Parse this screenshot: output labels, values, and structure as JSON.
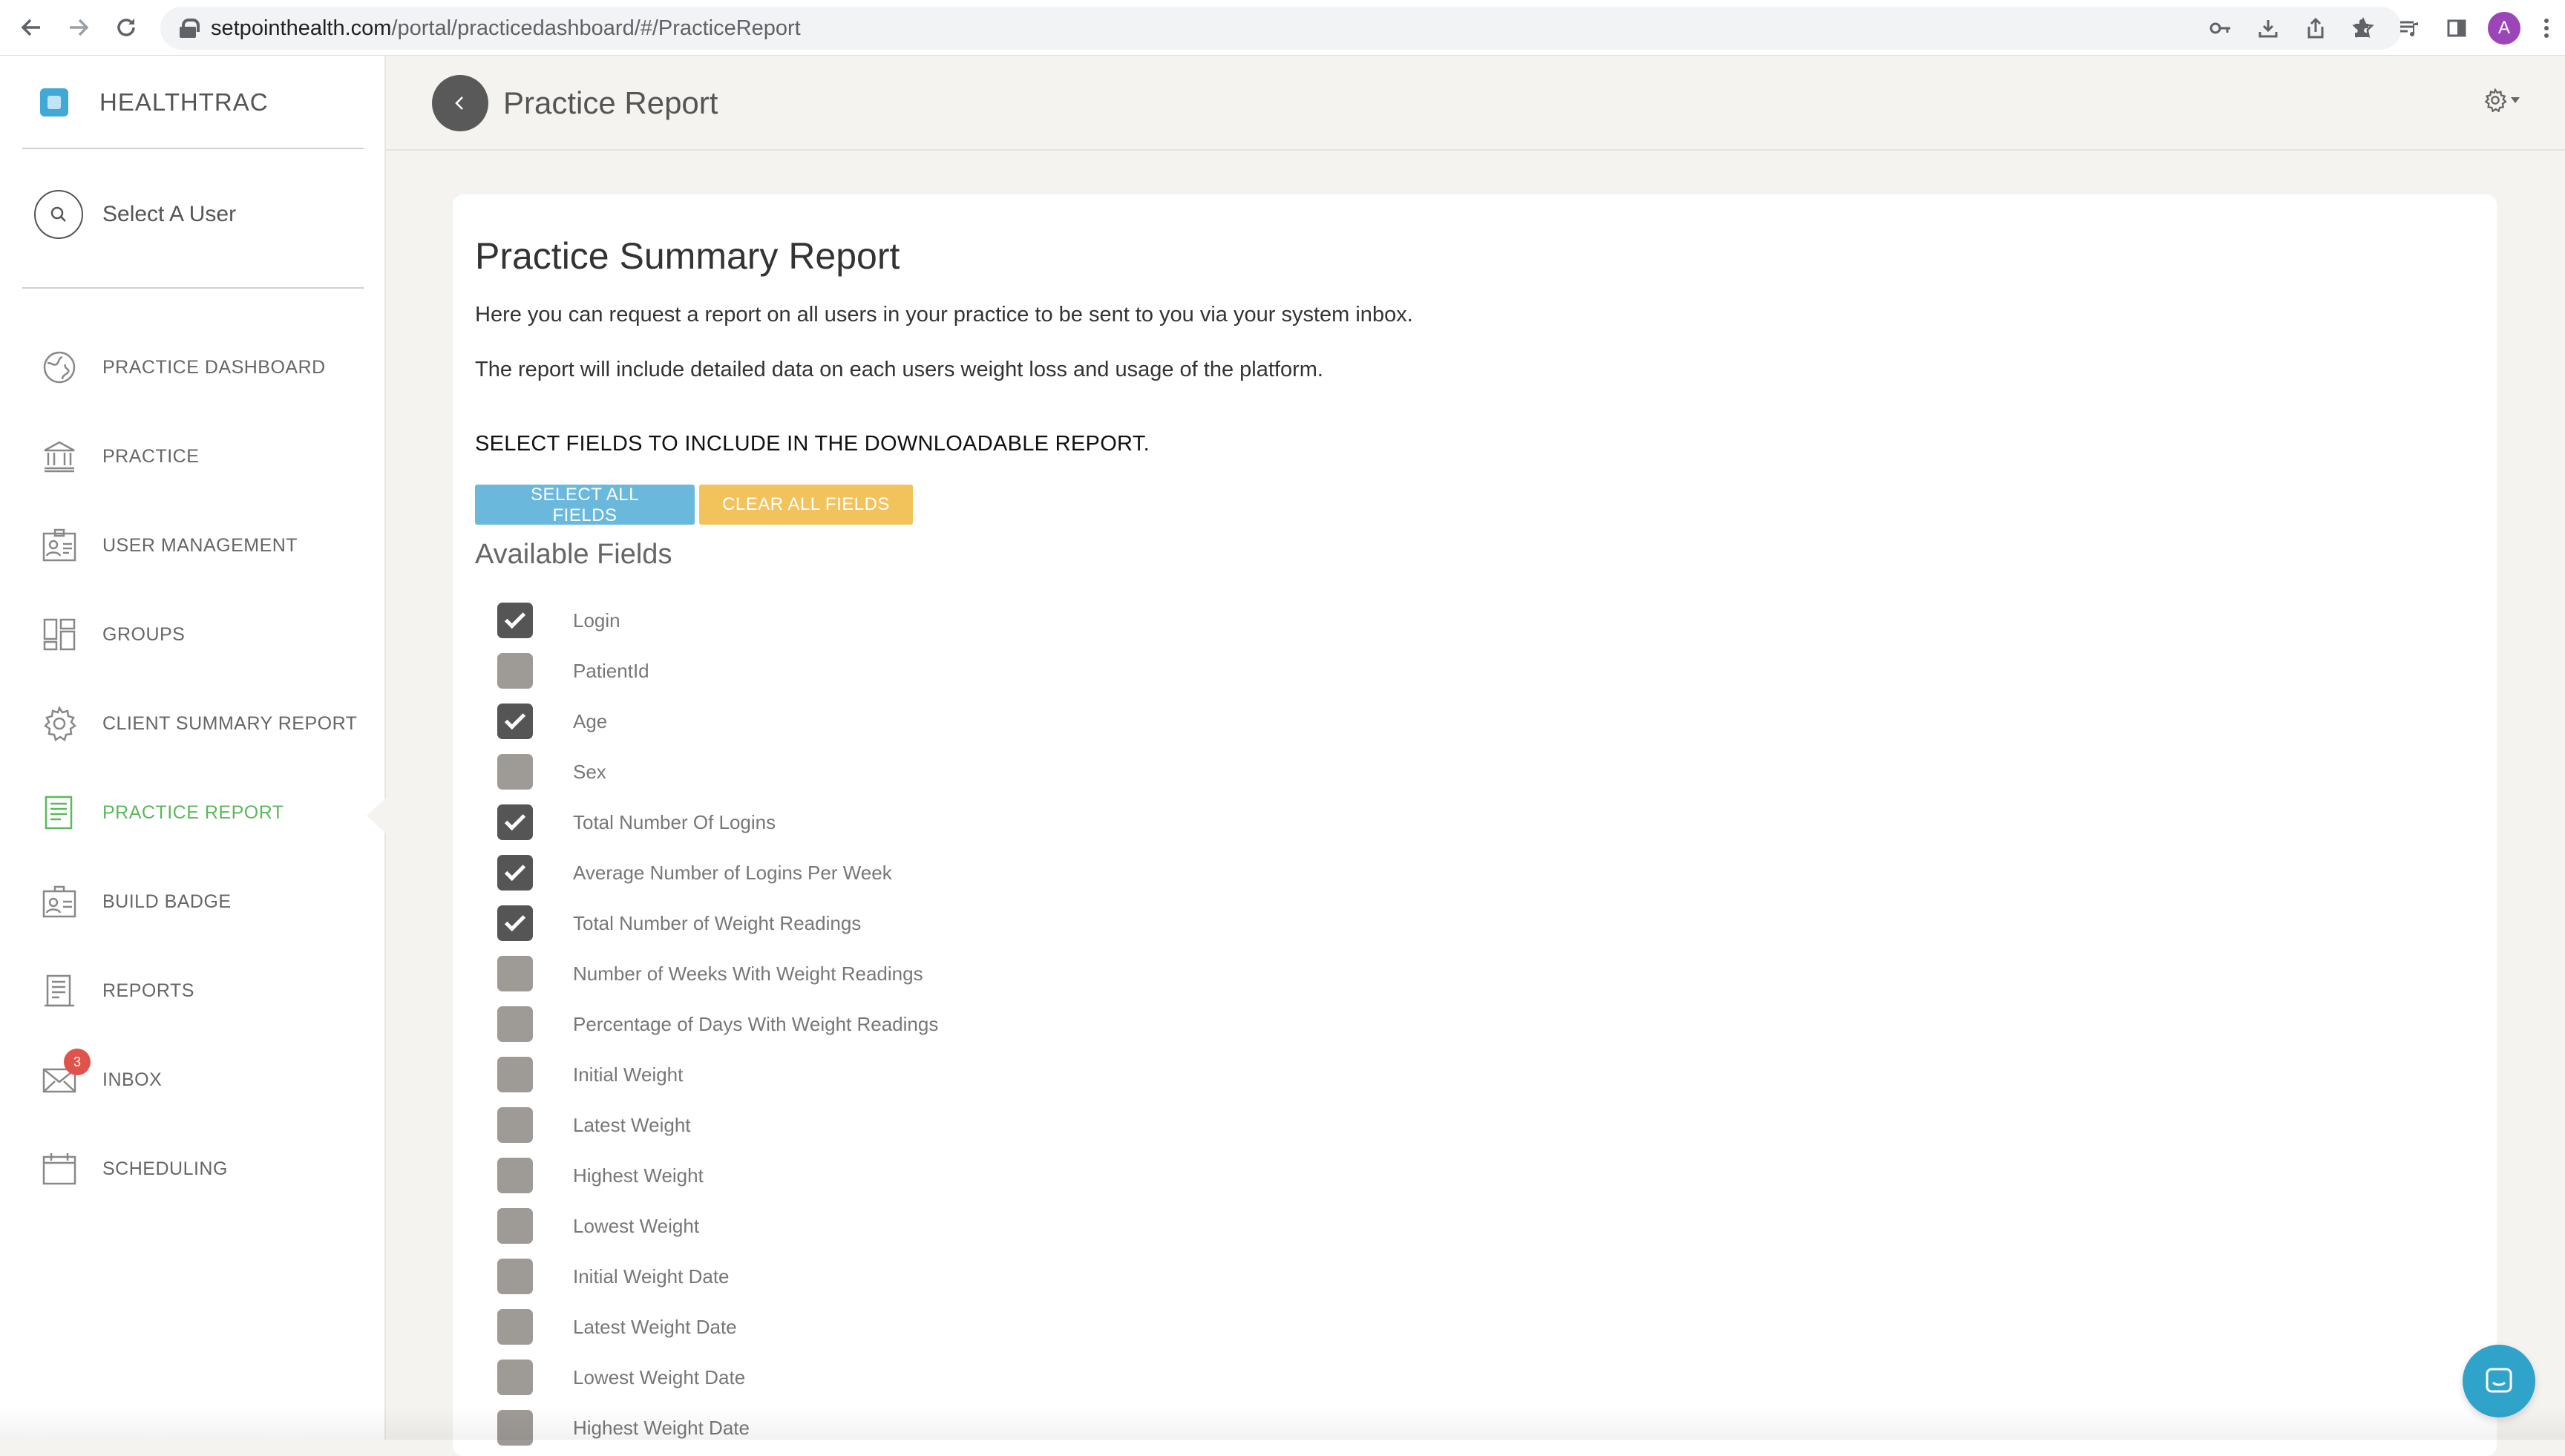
{
  "browser": {
    "url_host": "setpointhealth.com",
    "url_path": "/portal/practicedashboard/#/PracticeReport",
    "avatar_letter": "A"
  },
  "sidebar": {
    "brand": "HEALTHTRAC",
    "select_user": "Select A User",
    "items": [
      {
        "label": "PRACTICE DASHBOARD",
        "icon": "globe-icon"
      },
      {
        "label": "PRACTICE",
        "icon": "bank-icon"
      },
      {
        "label": "USER MANAGEMENT",
        "icon": "id-card-icon"
      },
      {
        "label": "GROUPS",
        "icon": "grid-icon"
      },
      {
        "label": "CLIENT SUMMARY REPORT",
        "icon": "gear-icon"
      },
      {
        "label": "PRACTICE REPORT",
        "icon": "document-icon",
        "active": true
      },
      {
        "label": "BUILD BADGE",
        "icon": "badge-icon"
      },
      {
        "label": "REPORTS",
        "icon": "reports-icon"
      },
      {
        "label": "INBOX",
        "icon": "envelope-icon",
        "badge": "3"
      },
      {
        "label": "SCHEDULING",
        "icon": "calendar-icon"
      }
    ]
  },
  "header": {
    "title": "Practice Report"
  },
  "report": {
    "title": "Practice Summary Report",
    "description_1": "Here you can request a report on all users in your practice to be sent to you via your system inbox.",
    "description_2": "The report will include detailed data on each users weight loss and usage of the platform.",
    "section_heading": "SELECT FIELDS TO INCLUDE IN THE DOWNLOADABLE REPORT.",
    "select_all_label": "SELECT ALL FIELDS",
    "clear_all_label": "CLEAR ALL FIELDS",
    "available_heading": "Available Fields",
    "fields": [
      {
        "label": "Login",
        "checked": true
      },
      {
        "label": "PatientId",
        "checked": false
      },
      {
        "label": "Age",
        "checked": true
      },
      {
        "label": "Sex",
        "checked": false
      },
      {
        "label": "Total Number Of Logins",
        "checked": true
      },
      {
        "label": "Average Number of Logins Per Week",
        "checked": true
      },
      {
        "label": "Total Number of Weight Readings",
        "checked": true
      },
      {
        "label": "Number of Weeks With Weight Readings",
        "checked": false
      },
      {
        "label": "Percentage of Days With Weight Readings",
        "checked": false
      },
      {
        "label": "Initial Weight",
        "checked": false
      },
      {
        "label": "Latest Weight",
        "checked": false
      },
      {
        "label": "Highest Weight",
        "checked": false
      },
      {
        "label": "Lowest Weight",
        "checked": false
      },
      {
        "label": "Initial Weight Date",
        "checked": false
      },
      {
        "label": "Latest Weight Date",
        "checked": false
      },
      {
        "label": "Lowest Weight Date",
        "checked": false
      },
      {
        "label": "Highest Weight Date",
        "checked": false
      }
    ]
  },
  "colors": {
    "accent_green": "#5cb85c",
    "select_all_blue": "#6ab9dd",
    "clear_all_yellow": "#f2c25b",
    "badge_red": "#e0534b",
    "chat_blue": "#2fa3c9"
  }
}
